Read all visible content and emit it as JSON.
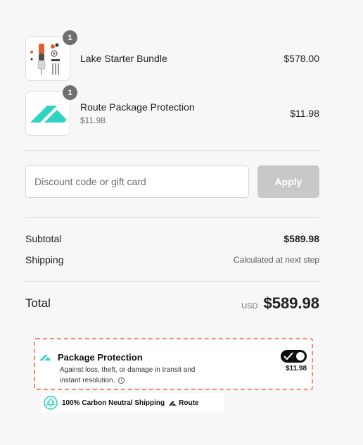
{
  "line_items": [
    {
      "name": "Lake Starter Bundle",
      "quantity": "1",
      "price": "$578.00",
      "subtitle": "",
      "image_icon": "fishing-bundle-product-image"
    },
    {
      "name": "Route Package Protection",
      "quantity": "1",
      "price": "$11.98",
      "subtitle": "$11.98",
      "image_icon": "route-logo-product-image"
    }
  ],
  "discount": {
    "placeholder": "Discount code or gift card",
    "value": "",
    "apply_label": "Apply"
  },
  "summary": {
    "subtotal_label": "Subtotal",
    "subtotal_value": "$589.98",
    "shipping_label": "Shipping",
    "shipping_value": "Calculated at next step"
  },
  "total": {
    "label": "Total",
    "currency": "USD",
    "amount": "$589.98"
  },
  "protection": {
    "title": "Package Protection",
    "description": "Against loss, theft, or damage in transit and instant resolution.",
    "price": "$11.98",
    "toggle_state": "on",
    "info_icon": "info-icon"
  },
  "carbon": {
    "text": "100% Carbon Neutral Shipping",
    "brand": "Route"
  },
  "colors": {
    "route_teal": "#2ed3c4",
    "dashed_border": "#ee8d6f",
    "apply_disabled": "#c8c8c8",
    "badge": "#6f6f6f"
  }
}
